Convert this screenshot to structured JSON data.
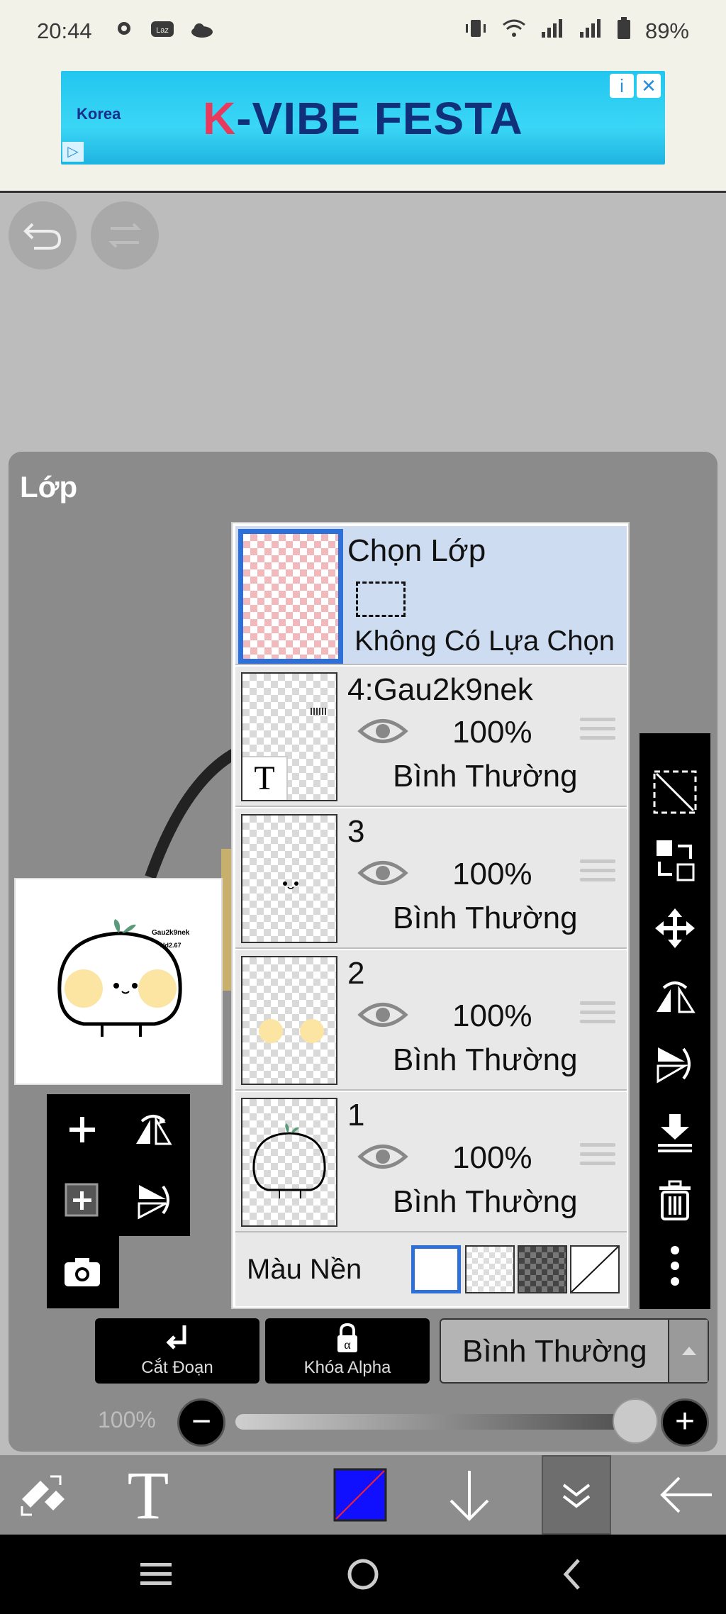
{
  "status_bar": {
    "time": "20:44",
    "battery": "89%"
  },
  "ad": {
    "title_k": "K",
    "title_rest": "-VIBE FESTA",
    "logo_text": "Korea",
    "info_icon": "i",
    "close_icon": "✕",
    "adchoice_icon": "▷"
  },
  "panel": {
    "title": "Lớp"
  },
  "preview": {
    "line1": "Gau2k9nek",
    "line2": "Hd2.67"
  },
  "selection_layer": {
    "title": "Chọn Lớp",
    "subtitle": "Không Có Lựa Chọn"
  },
  "layers": [
    {
      "name": "4:Gau2k9nek",
      "opacity": "100%",
      "blend": "Bình Thường",
      "has_text_icon": true
    },
    {
      "name": "3",
      "opacity": "100%",
      "blend": "Bình Thường"
    },
    {
      "name": "2",
      "opacity": "100%",
      "blend": "Bình Thường"
    },
    {
      "name": "1",
      "opacity": "100%",
      "blend": "Bình Thường"
    }
  ],
  "background_row": {
    "label": "Màu Nền"
  },
  "bottom_controls": {
    "clip_label": "Cắt Đoạn",
    "alpha_lock_label": "Khóa Alpha",
    "blend_mode": "Bình Thường",
    "opacity_label": "100%",
    "minus": "−",
    "plus": "+"
  },
  "toolbar": {
    "text_tool": "T",
    "color_swatch": "#1010ff"
  },
  "icons": {
    "undo": "undo-icon",
    "redo": "redo-icon",
    "add": "plus-icon",
    "flip": "flip-horizontal-icon",
    "camera": "camera-icon",
    "delete": "trash-icon",
    "more": "more-vertical-icon"
  }
}
